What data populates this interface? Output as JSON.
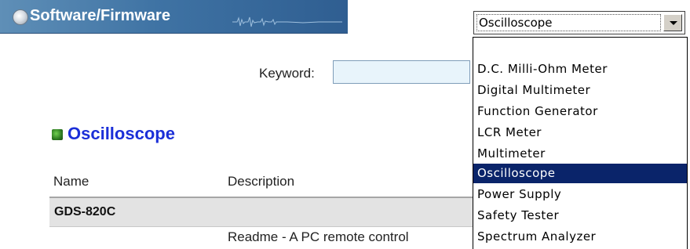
{
  "banner": {
    "title": "Software/Firmware"
  },
  "search": {
    "keyword_label": "Keyword:",
    "keyword_value": ""
  },
  "category_select": {
    "selected": "Oscilloscope",
    "options": [
      "",
      "D.C. Milli-Ohm Meter",
      "Digital Multimeter",
      "Function Generator",
      "LCR Meter",
      "Multimeter",
      "Oscilloscope",
      "Power Supply",
      "Safety Tester",
      "Spectrum Analyzer"
    ],
    "highlighted_index": 6
  },
  "section": {
    "title": "Oscilloscope"
  },
  "table": {
    "headers": [
      "Name",
      "Description"
    ],
    "product": "GDS-820C",
    "item_description": "Readme - A PC remote control"
  },
  "colors": {
    "banner": "#3f73a4",
    "section_title": "#1b2fd8",
    "highlight": "#0a246a"
  }
}
